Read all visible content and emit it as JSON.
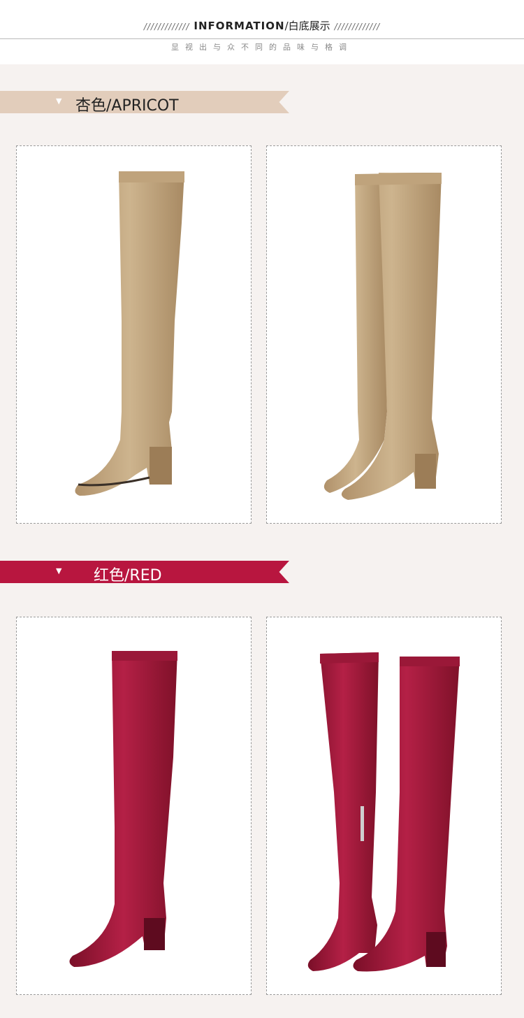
{
  "header": {
    "deco_left": "/////////////",
    "title_en": "INFORMATION",
    "title_cn": "/白底展示",
    "deco_right": "/////////////",
    "subtitle": "显视出与众不同的品味与格调"
  },
  "sections": [
    {
      "label": "杏色/APRICOT",
      "color": "#e2cdbb"
    },
    {
      "label": "红色/RED",
      "color": "#b8163f"
    }
  ],
  "boot_colors": {
    "apricot": "#c4a982",
    "red": "#a81a3c"
  }
}
